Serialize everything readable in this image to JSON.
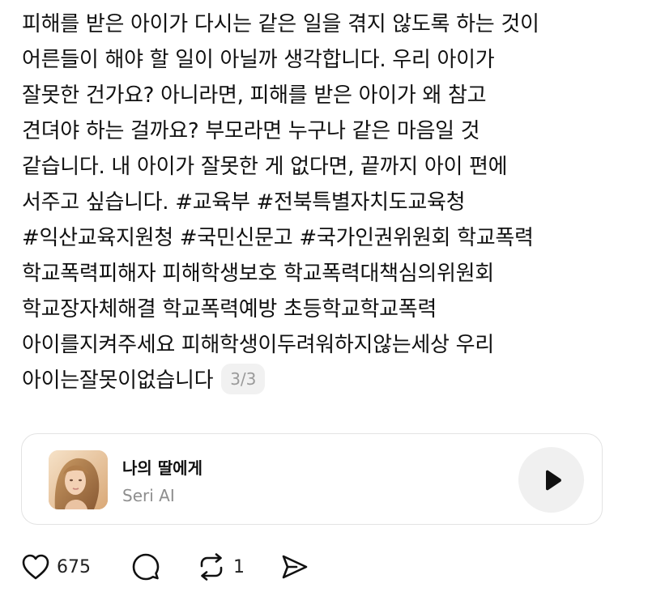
{
  "post": {
    "lines": [
      "피해를 받은 아이가 다시는 같은 일을 겪지 않도록 하는 것이",
      "어른들이 해야 할 일이 아닐까 생각합니다. 우리 아이가",
      "잘못한 건가요? 아니라면, 피해를 받은 아이가 왜 참고",
      "견뎌야 하는 걸까요? 부모라면 누구나 같은 마음일 것",
      "같습니다. 내 아이가 잘못한 게 없다면, 끝까지 아이 편에",
      "서주고 싶습니다. #교육부 #전북특별자치도교육청",
      "#익산교육지원청 #국민신문고 #국가인권위원회 학교폭력",
      "학교폭력피해자 피해학생보호 학교폭력대책심의위원회",
      "학교장자체해결 학교폭력예방 초등학교학교폭력",
      "아이를지켜주세요 피해학생이두려워하지않는세상 우리",
      "아이는잘못이없습니다"
    ],
    "page_indicator": "3/3"
  },
  "music": {
    "title": "나의 딸에게",
    "artist": "Seri AI",
    "album_icon": "album-cover-portrait",
    "play_icon": "play-icon"
  },
  "actions": {
    "like_count": "675",
    "repost_count": "1",
    "icons": [
      "heart-icon",
      "comment-icon",
      "repost-icon",
      "share-icon"
    ]
  },
  "colors": {
    "text": "#111111",
    "muted": "#8e8e8e",
    "badge_bg": "#f1f1f1",
    "card_border": "#e3e3e3",
    "play_bg": "#f0f0f0"
  }
}
